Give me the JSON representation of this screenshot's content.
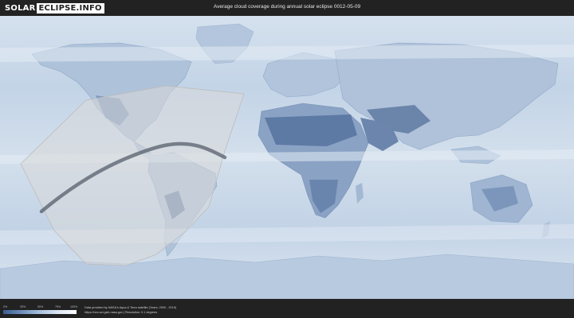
{
  "header": {
    "logo_left": "SOLAR",
    "logo_right": "ECLIPSE.INFO",
    "title": "Average cloud coverage during annual solar eclipse 0012-05-09"
  },
  "legend": {
    "ticks": [
      "0%",
      "25%",
      "50%",
      "75%",
      "100%"
    ],
    "colors": [
      "#3b5f92",
      "#6f8fb8",
      "#a9c0dc",
      "#dce7f3",
      "#ffffff"
    ]
  },
  "footer": {
    "credit_line_1": "Data provided by NASA's Aqua & Terra satellite (Years: 2000 - 2019)",
    "credit_line_2": "https://neo.sci.gsfc.nasa.gov | Resolution: 0.1 degrees"
  },
  "map": {
    "ocean_color": "#c9d8e8",
    "land_color": "#a9bdd6",
    "dry_land_color": "#6f88ae",
    "eclipse_zone_color": "#d8d8d8",
    "central_line_color": "#555f6b"
  }
}
